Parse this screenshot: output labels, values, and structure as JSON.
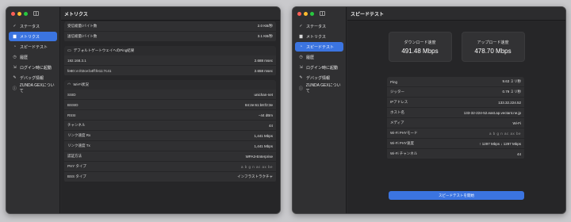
{
  "sidebar": {
    "items": [
      {
        "icon": "check-icon",
        "glyph": "✓",
        "label": "ステータス"
      },
      {
        "icon": "chart-icon",
        "glyph": "▆",
        "label": "メトリクス"
      },
      {
        "icon": "speedometer-icon",
        "glyph": "◔",
        "label": "スピードテスト"
      },
      {
        "icon": "clock-icon",
        "glyph": "◷",
        "label": "履歴"
      },
      {
        "icon": "login-icon",
        "glyph": "⇲",
        "label": "ログイン時に起動"
      },
      {
        "icon": "wrench-icon",
        "glyph": "✎",
        "label": "デバッグ情報"
      },
      {
        "icon": "info-icon",
        "glyph": "ⓘ",
        "label": "ZUNDA GEXについて"
      }
    ]
  },
  "left_window": {
    "title": "メトリクス",
    "active_index": 1,
    "transfer_rows": [
      {
        "label": "受信総量/バイト数",
        "value": "2.0 KB/秒"
      },
      {
        "label": "送信総量/バイト数",
        "value": "3.1 KB/秒"
      }
    ],
    "ping_section": {
      "title": "デフォルトゲートウェイへのPing結果",
      "rows": [
        {
          "label": "192.168.3.1",
          "value": "2.688 msec"
        },
        {
          "label": "fe80::e:/02ce:b4ff:fe11:7c41",
          "value": "2.658 msec"
        }
      ]
    },
    "wifi_section": {
      "title": "Wi-Fi状況",
      "rows": [
        {
          "label": "SSID",
          "value": "unichan-net"
        },
        {
          "label": "BSSID",
          "value": "84:2e:61:b8:f2:3e"
        },
        {
          "label": "RSSI",
          "value": "−44 dBm"
        },
        {
          "label": "チャンネル",
          "value": "44"
        },
        {
          "label": "リンク速度 Rx",
          "value": "1,441 Mbps"
        },
        {
          "label": "リンク速度 Tx",
          "value": "1,441 Mbps"
        },
        {
          "label": "認証方法",
          "value": "WPA3-Enterprise"
        },
        {
          "label": "PHY タイプ",
          "value": "a b g n ac ax be"
        },
        {
          "label": "BSS タイプ",
          "value": "インフラストラクチャ"
        }
      ]
    }
  },
  "right_window": {
    "title": "スピードテスト",
    "active_index": 2,
    "download": {
      "label": "ダウンロード速度",
      "value": "491.48 Mbps"
    },
    "upload": {
      "label": "アップロード速度",
      "value": "478.70 Mbps"
    },
    "rows": [
      {
        "label": "Ping",
        "value": "9.63 ミリ秒"
      },
      {
        "label": "ジッター",
        "value": "0.79 ミリ秒"
      },
      {
        "label": "IPアドレス",
        "value": "133.32.224.52"
      },
      {
        "label": "ホスト名",
        "value": "133-32-224-52.east.ap.vectant.ne.jp"
      },
      {
        "label": "メディア",
        "value": "Wi-Fi"
      },
      {
        "label": "Wi-Fi PHYモード",
        "value": "a b g n ac ax be"
      },
      {
        "label": "Wi-Fi PHY速度",
        "value": "↑ 1297 Mbps  ↓ 1297 Mbps"
      },
      {
        "label": "Wi-Fi チャンネル",
        "value": "44"
      }
    ],
    "button_label": "スピードテストを開始"
  }
}
